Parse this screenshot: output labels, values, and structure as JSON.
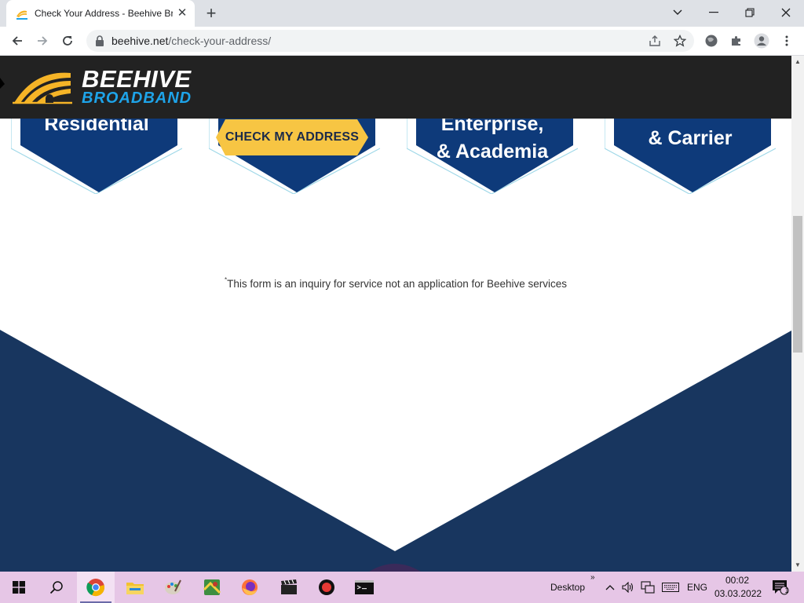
{
  "browser": {
    "tab_title": "Check Your Address - Beehive Br",
    "tab_favicon_text": "BEEHIVE",
    "url_host": "beehive.net",
    "url_path": "/check-your-address/"
  },
  "site": {
    "logo_top": "BEEHIVE",
    "logo_bottom": "BROADBAND",
    "cards": [
      {
        "line1": "Residential"
      },
      {
        "line1": ""
      },
      {
        "line1": "Enterprise,",
        "line2": "& Academia"
      },
      {
        "line1": "& Carrier"
      }
    ],
    "cta_label": "CHECK MY ADDRESS",
    "disclaimer_mark": "*",
    "disclaimer": "This form is an inquiry for service not an application for Beehive services"
  },
  "taskbar": {
    "desktop_label": "Desktop",
    "chevron": "»",
    "language": "ENG",
    "time": "00:02",
    "date": "03.03.2022",
    "notification_count": "1"
  },
  "colors": {
    "header_bg": "#222222",
    "hex_navy": "#0e3a7a",
    "hex_outline": "#9fd8e8",
    "cta_yellow": "#f7c543",
    "bottom_navy": "#18365f",
    "logo_blue": "#1ea4e9",
    "logo_gold": "#f5b427",
    "taskbar_bg": "#e6c6e6"
  }
}
